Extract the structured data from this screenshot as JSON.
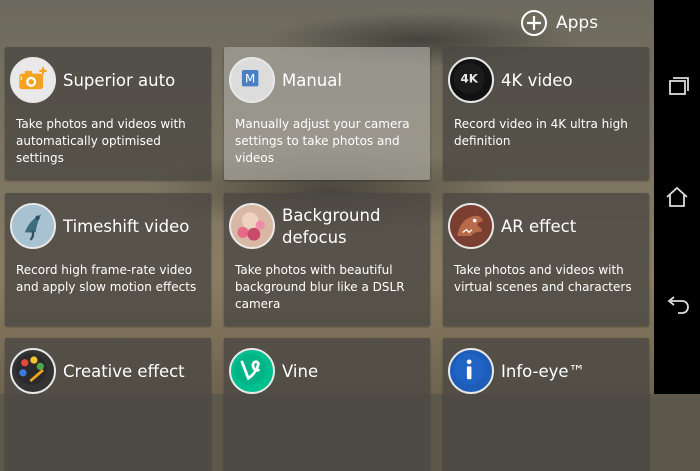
{
  "header": {
    "apps_label": "Apps",
    "apps_icon": "add-circle-icon"
  },
  "modes": [
    {
      "title": "Superior auto",
      "description": "Take photos and videos with automatically optimised settings",
      "icon": "superior-auto-icon",
      "selected": false
    },
    {
      "title": "Manual",
      "description": "Manually adjust your camera settings to take photos and videos",
      "icon": "manual-mode-icon",
      "selected": true
    },
    {
      "title": "4K video",
      "description": "Record video in 4K ultra high definition",
      "icon": "4k-video-icon",
      "selected": false
    },
    {
      "title": "Timeshift video",
      "description": "Record high frame-rate video and apply slow motion effects",
      "icon": "timeshift-video-icon",
      "selected": false
    },
    {
      "title": "Background defocus",
      "description": "Take photos with beautiful background blur like a DSLR camera",
      "icon": "background-defocus-icon",
      "selected": false
    },
    {
      "title": "AR effect",
      "description": "Take photos and videos with virtual scenes and characters",
      "icon": "ar-effect-icon",
      "selected": false
    },
    {
      "title": "Creative effect",
      "description": "",
      "icon": "creative-effect-icon",
      "selected": false
    },
    {
      "title": "Vine",
      "description": "",
      "icon": "vine-icon",
      "selected": false
    },
    {
      "title": "Info-eye™",
      "description": "",
      "icon": "info-eye-icon",
      "selected": false
    }
  ],
  "navbar": {
    "recents_icon": "recents-icon",
    "home_icon": "home-icon",
    "back_icon": "back-icon"
  }
}
